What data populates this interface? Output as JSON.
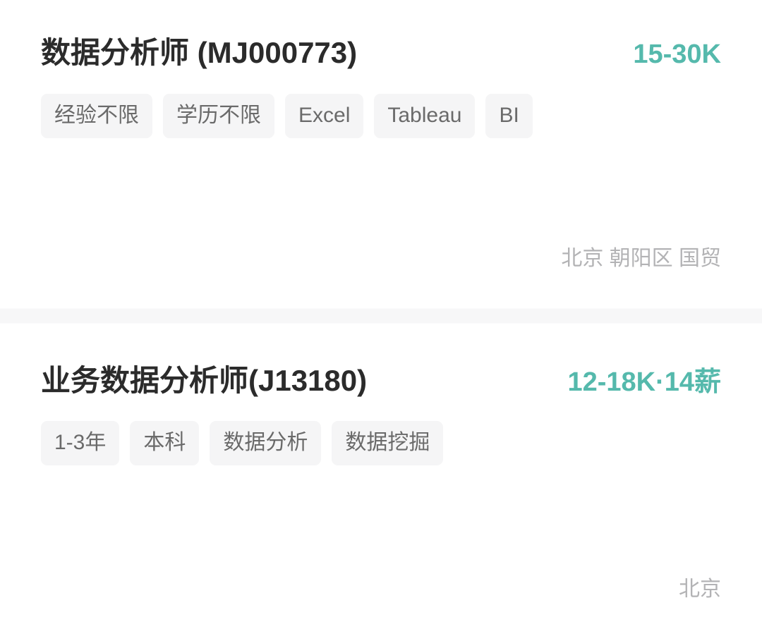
{
  "theme": {
    "page_background": "#ffffff",
    "salary_accent": "#55b9ac",
    "title_color": "#2b2b2b",
    "tag_background": "#f5f5f6",
    "tag_text": "#6a6a6a",
    "location_text": "#b3b3b5",
    "separator": "#f7f7f8"
  },
  "job_list": [
    {
      "title": "数据分析师 (MJ000773)",
      "salary": "15-30K",
      "tags": [
        "经验不限",
        "学历不限",
        "Excel",
        "Tableau",
        "BI"
      ],
      "location": "北京 朝阳区 国贸"
    },
    {
      "title": "业务数据分析师(J13180)",
      "salary": "12-18K·14薪",
      "tags": [
        "1-3年",
        "本科",
        "数据分析",
        "数据挖掘"
      ],
      "location": "北京"
    }
  ]
}
